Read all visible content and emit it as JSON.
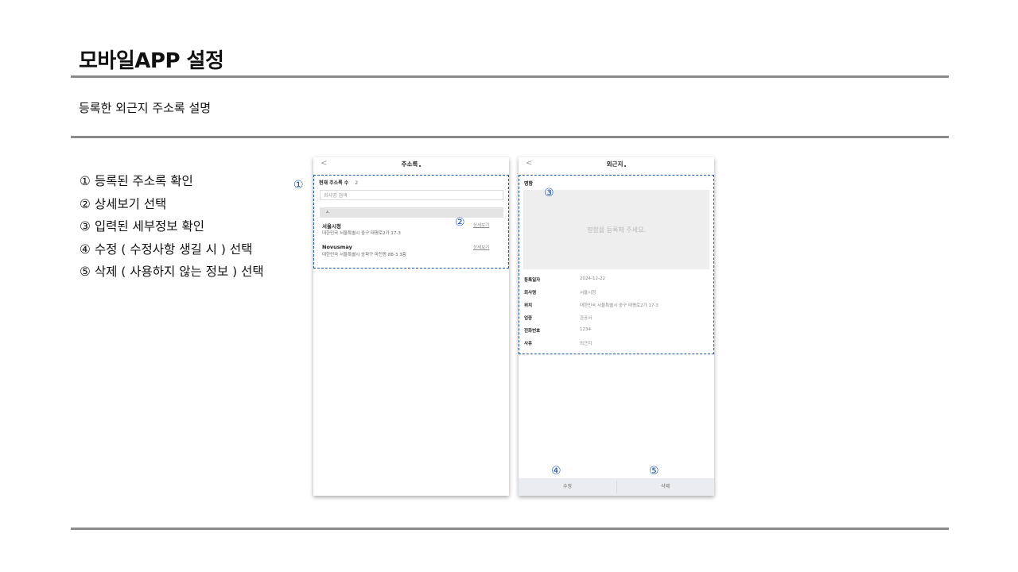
{
  "page": {
    "title": "모바일APP 설정",
    "subtitle": "등록한 외근지 주소록 설명"
  },
  "steps": [
    "① 등록된 주소록 확인",
    "② 상세보기 선택",
    "③ 입력된 세부정보 확인",
    "④ 수정 ( 수정사항 생길 시 ) 선택",
    "⑤ 삭제 ( 사용하지 않는 정보 ) 선택"
  ],
  "markers": [
    "①",
    "②",
    "③",
    "④",
    "⑤"
  ],
  "address_screen": {
    "back": "<",
    "title": "주소록",
    "count_label": "현재 주소록 수",
    "count_value": "2",
    "search_placeholder": "회사명 검색",
    "group_header": "ㅅ",
    "entries": [
      {
        "name": "서울시청",
        "address": "대한민국 서울특별시 중구 태평로2가 17-3",
        "link": "상세보기"
      },
      {
        "name": "Novusmay",
        "address": "대한민국 서울특별시 송파구 마천동 88-3 3층",
        "link": "상세보기"
      }
    ]
  },
  "detail_screen": {
    "back": "<",
    "title": "외근지",
    "card_label": "명함",
    "card_placeholder": "명함을 등록해 주세요.",
    "rows": [
      {
        "label": "등록일자",
        "value": "2024-12-22"
      },
      {
        "label": "회사명",
        "value": "서울시청"
      },
      {
        "label": "위치",
        "value": "대한민국 서울특별시 중구 태평로2가 17-3"
      },
      {
        "label": "업종",
        "value": "관공서"
      },
      {
        "label": "전화번호",
        "value": "1234"
      },
      {
        "label": "사유",
        "value": "외근지"
      }
    ],
    "edit_button": "수정",
    "delete_button": "삭제"
  },
  "colors": {
    "accent": "#1f57a5",
    "divider": "#8a8a8a",
    "button_bar": "#e9edf2",
    "card_bg": "#eeeeee"
  }
}
